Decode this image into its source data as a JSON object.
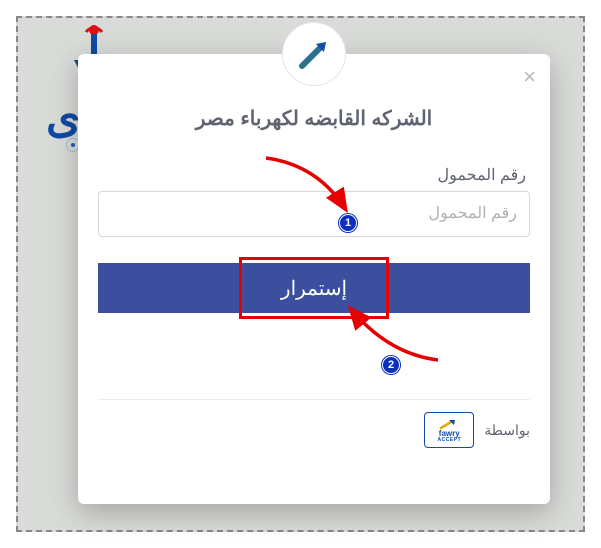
{
  "modal": {
    "title": "الشركه القابضه لكهرباء مصر",
    "close_glyph": "×",
    "mobile_label": "رقم المحمول",
    "mobile_placeholder": "رقم المحمول",
    "continue_label": "إستمرار"
  },
  "footer": {
    "powered_by_label": "بواسطة",
    "provider_name": "fawry",
    "provider_sub": "ACCEPT"
  },
  "callouts": {
    "step1": "1",
    "step2": "2"
  }
}
